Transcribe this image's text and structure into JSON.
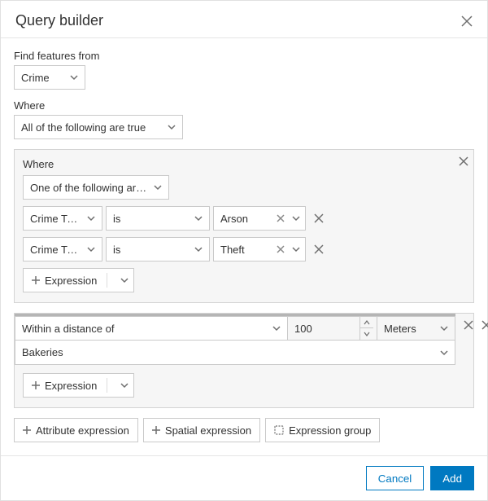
{
  "title": "Query builder",
  "labels": {
    "findFrom": "Find features from",
    "where": "Where"
  },
  "source": {
    "layer": "Crime"
  },
  "topOperator": "All of the following are true",
  "group1": {
    "label": "Where",
    "operator": "One of the following are tr…",
    "rows": [
      {
        "field": "Crime Type",
        "op": "is",
        "value": "Arson"
      },
      {
        "field": "Crime Type",
        "op": "is",
        "value": "Theft"
      }
    ],
    "addExpression": "Expression"
  },
  "spatial": {
    "relation": "Within a distance of",
    "distance": "100",
    "unit": "Meters",
    "layer": "Bakeries",
    "addExpression": "Expression"
  },
  "buttons": {
    "attrExpr": "Attribute expression",
    "spatialExpr": "Spatial expression",
    "exprGroup": "Expression group",
    "cancel": "Cancel",
    "add": "Add"
  }
}
